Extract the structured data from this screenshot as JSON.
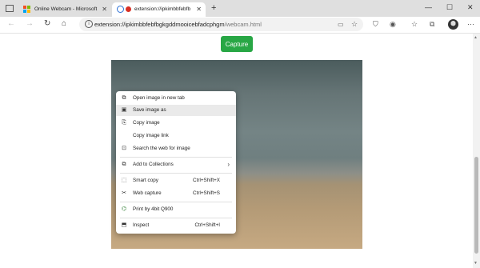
{
  "tabs": [
    {
      "title": "Online Webcam - Microsoft Edge"
    },
    {
      "title": "extension://ipkimbbfebfbgk"
    }
  ],
  "address_bar": {
    "url_host": "extension://ipkimbbfebfbgkgddmooicebfadcphgm",
    "url_path": "/webcam.html"
  },
  "page": {
    "capture_label": "Capture"
  },
  "context_menu": {
    "items": [
      {
        "label": "Open image in new tab",
        "shortcut": ""
      },
      {
        "label": "Save image as",
        "shortcut": ""
      },
      {
        "label": "Copy image",
        "shortcut": ""
      },
      {
        "label": "Copy image link",
        "shortcut": ""
      },
      {
        "label": "Search the web for image",
        "shortcut": ""
      },
      {
        "label": "Add to Collections",
        "shortcut": ""
      },
      {
        "label": "Smart copy",
        "shortcut": "Ctrl+Shift+X"
      },
      {
        "label": "Web capture",
        "shortcut": "Ctrl+Shift+S"
      },
      {
        "label": "Print by 4bit Q900",
        "shortcut": ""
      },
      {
        "label": "Inspect",
        "shortcut": "Ctrl+Shift+I"
      }
    ],
    "highlighted": "Save image as"
  },
  "colors": {
    "capture_button": "#28a745",
    "menu_highlight": "#eaeaea"
  }
}
